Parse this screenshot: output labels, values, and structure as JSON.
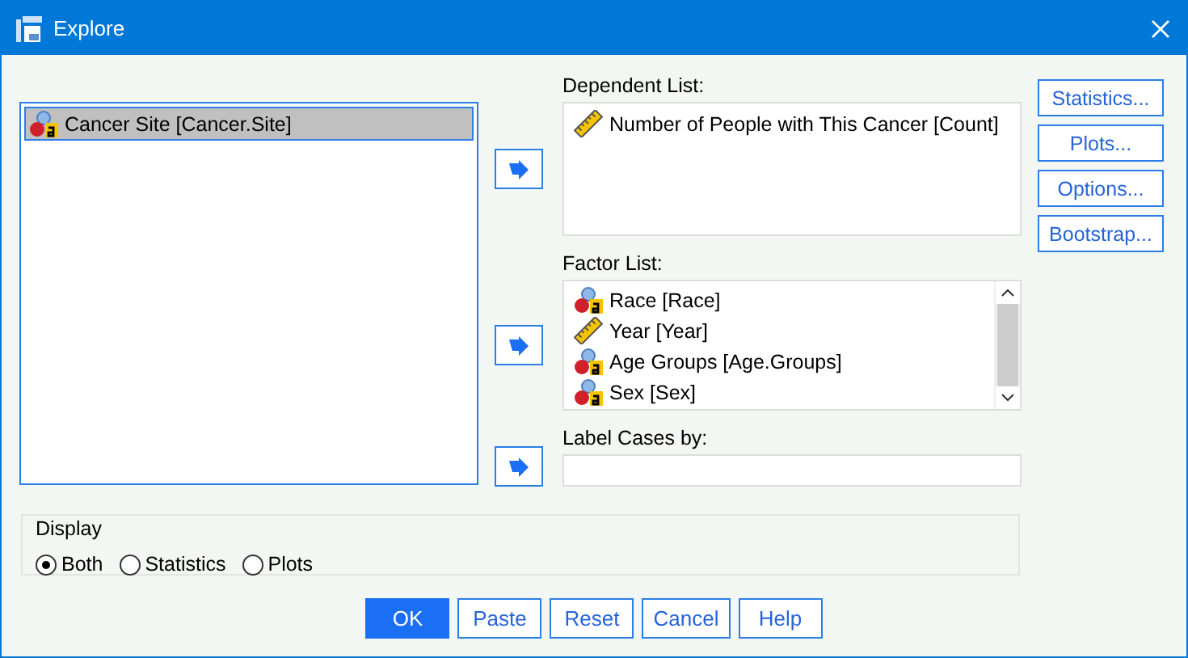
{
  "window": {
    "title": "Explore"
  },
  "source_list": {
    "items": [
      {
        "label": "Cancer Site [Cancer.Site]",
        "kind": "nominal",
        "selected": true
      }
    ]
  },
  "dependent_list": {
    "label": "Dependent List:",
    "items": [
      {
        "label": "Number of People with This Cancer [Count]",
        "kind": "scale"
      }
    ]
  },
  "factor_list": {
    "label": "Factor List:",
    "items": [
      {
        "label": "Race [Race]",
        "kind": "nominal"
      },
      {
        "label": "Year [Year]",
        "kind": "scale"
      },
      {
        "label": "Age Groups [Age.Groups]",
        "kind": "nominal"
      },
      {
        "label": "Sex [Sex]",
        "kind": "nominal"
      }
    ]
  },
  "label_cases": {
    "label": "Label Cases by:"
  },
  "side_buttons": [
    "Statistics...",
    "Plots...",
    "Options...",
    "Bootstrap..."
  ],
  "display": {
    "title": "Display",
    "options": [
      {
        "label": "Both",
        "selected": true
      },
      {
        "label": "Statistics",
        "selected": false
      },
      {
        "label": "Plots",
        "selected": false
      }
    ]
  },
  "buttons": [
    {
      "label": "OK",
      "primary": true
    },
    {
      "label": "Paste",
      "primary": false
    },
    {
      "label": "Reset",
      "primary": false
    },
    {
      "label": "Cancel",
      "primary": false
    },
    {
      "label": "Help",
      "primary": false
    }
  ]
}
